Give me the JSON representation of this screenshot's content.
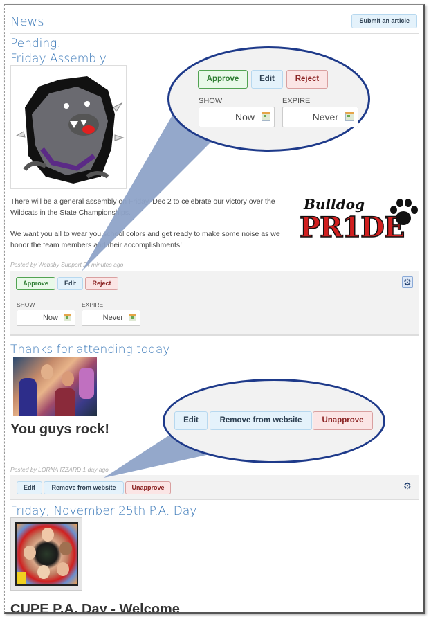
{
  "header": {
    "title": "News",
    "submit_label": "Submit an article"
  },
  "articles": [
    {
      "status_label": "Pending:",
      "title": "Friday Assembly",
      "image_alt": "Bulldog mascot",
      "logo_text_script": "Bulldog",
      "logo_text_main": "PR1DE",
      "paragraphs": [
        "There will be a general assembly on Friday, Dec 2 to celebrate our victory over the Wildcats in the State Championships.",
        "We want you all to wear you school colors and get ready to make some noise as we honor the team members and their accomplishments!"
      ],
      "posted_by": "Posted by Websby Support 24 minutes ago",
      "actions": {
        "approve": "Approve",
        "edit": "Edit",
        "reject": "Reject",
        "show_label": "SHOW",
        "show_value": "Now",
        "expire_label": "EXPIRE",
        "expire_value": "Never"
      }
    },
    {
      "title": "Thanks for attending today",
      "image_alt": "Students group photo",
      "headline": "You guys rock!",
      "posted_by": "Posted by LORNA IZZARD 1 day ago",
      "actions": {
        "edit": "Edit",
        "remove": "Remove from website",
        "unapprove": "Unapprove"
      }
    },
    {
      "title": "Friday, November 25th P.A. Day",
      "image_alt": "Students lying in a circle",
      "headline": "CUPE P.A. Day - Welcome"
    }
  ],
  "callouts": {
    "pending": {
      "approve": "Approve",
      "edit": "Edit",
      "reject": "Reject",
      "show_label": "SHOW",
      "show_value": "Now",
      "expire_label": "EXPIRE",
      "expire_value": "Never"
    },
    "approved": {
      "edit": "Edit",
      "remove": "Remove from website",
      "unapprove": "Unapprove"
    }
  },
  "colors": {
    "accent_blue": "#3a78b8",
    "approve_green": "#2e7d32",
    "reject_red": "#8b2323",
    "callout_border": "#1e3a8a",
    "callout_tail": "#8ea3c8"
  }
}
